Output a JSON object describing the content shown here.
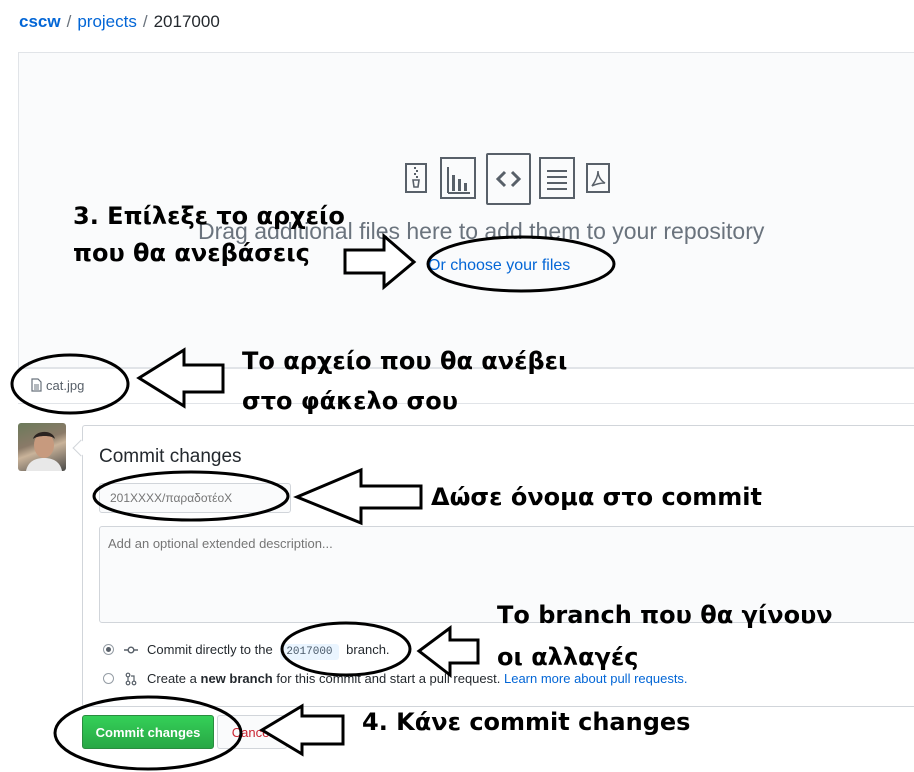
{
  "breadcrumb": {
    "owner": "cscw",
    "separator": "/",
    "repo": "projects",
    "current": "2017000"
  },
  "upload": {
    "drag_text": "Drag additional files here to add them to your repository",
    "choose_link": "Or choose your files",
    "file_type_icons": [
      "zip-file-icon",
      "chart-file-icon",
      "code-file-icon",
      "text-file-icon",
      "pdf-file-icon"
    ]
  },
  "files": [
    {
      "name": "cat.jpg",
      "icon": "file-icon"
    }
  ],
  "commit": {
    "title": "Commit changes",
    "summary_placeholder": "201XXXX/παραδοτέοX",
    "description_placeholder": "Add an optional extended description...",
    "option_direct": {
      "prefix": "Commit directly to the",
      "branch": "2017000",
      "suffix": "branch.",
      "checked": true
    },
    "option_new": {
      "prefix": "Create a",
      "bold": "new branch",
      "middle": "for this commit and start a pull request.",
      "link": "Learn more about pull requests.",
      "checked": false
    },
    "commit_button": "Commit changes",
    "cancel_button": "Cancel"
  },
  "annotations": {
    "step3_line1": "3. Επίλεξε το αρχείο",
    "step3_line2": "που θα ανεβάσεις",
    "file_line1": "Το αρχείο που θα ανέβει",
    "file_line2": "στο φάκελο σου",
    "name_commit": "Δώσε όνομα στο commit",
    "branch_line1": "Το branch που θα γίνουν",
    "branch_line2": "οι αλλαγές",
    "step4": "4. Κάνε commit changes"
  },
  "colors": {
    "link": "#0366d6",
    "commit_button": "#28a745",
    "cancel_text": "#cb2431",
    "annotation": "#000000"
  }
}
